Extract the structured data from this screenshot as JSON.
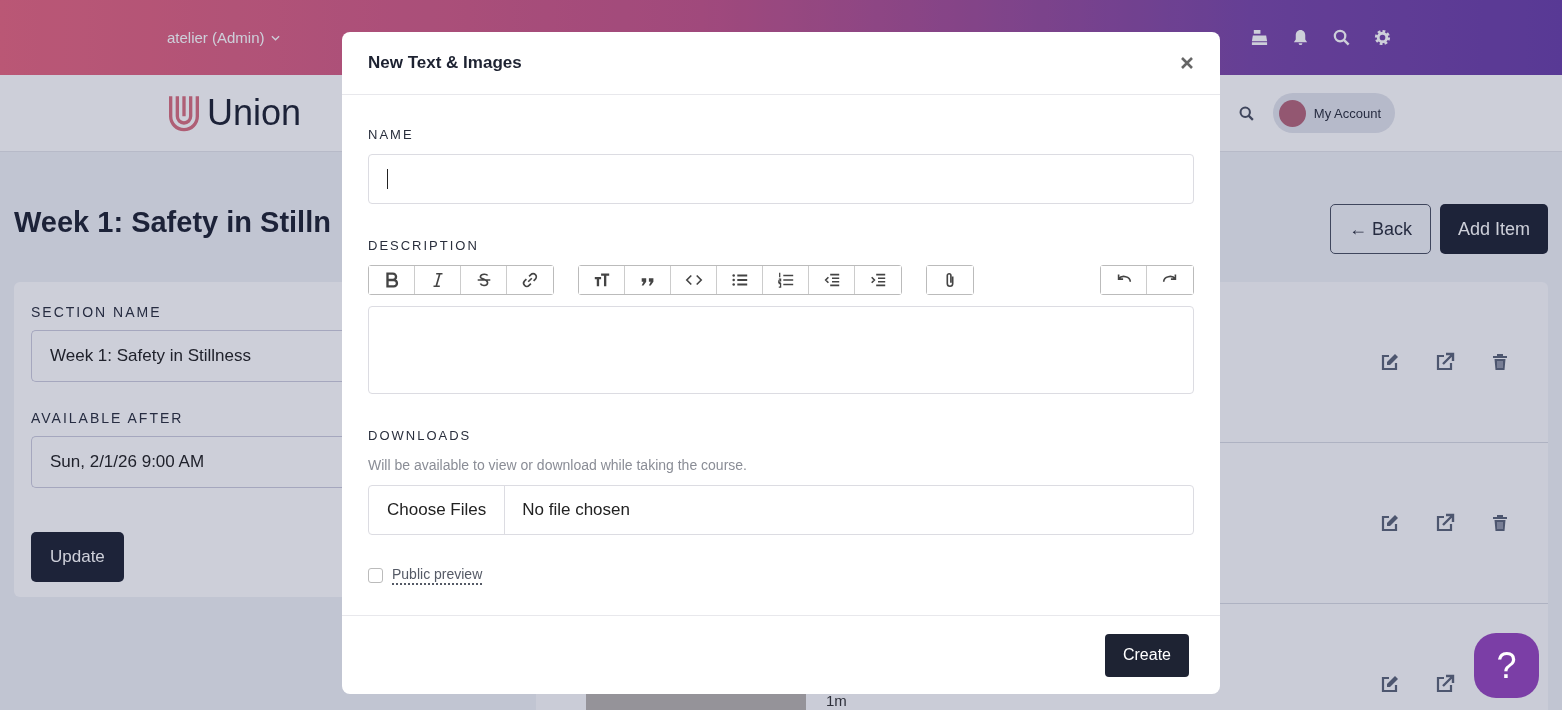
{
  "topbar": {
    "account_switcher": "atelier (Admin)"
  },
  "header": {
    "logo_text": "Union",
    "account_button": "My Account"
  },
  "page": {
    "title": "Week 1: Safety in Stilln",
    "back_button": "← Back",
    "add_button": "Add Item"
  },
  "section_form": {
    "fields": [
      {
        "label": "SECTION NAME",
        "value": "Week 1: Safety in Stillness"
      },
      {
        "label": "AVAILABLE AFTER",
        "value": "Sun, 2/1/26 9:00 AM"
      }
    ],
    "submit": "Update"
  },
  "items": [
    {
      "kind": "hidden"
    },
    {
      "kind": "hidden"
    },
    {
      "kind": "lesson",
      "duration": "1m"
    }
  ],
  "modal": {
    "title": "New Text & Images",
    "name_label": "NAME",
    "description_label": "DESCRIPTION",
    "downloads_label": "DOWNLOADS",
    "downloads_hint": "Will be available to view or download while taking the course.",
    "choose_button": "Choose Files",
    "file_status": "No file chosen",
    "public_preview": {
      "label": "Public preview",
      "checked": false
    },
    "create_button": "Create"
  },
  "help_button": "?"
}
